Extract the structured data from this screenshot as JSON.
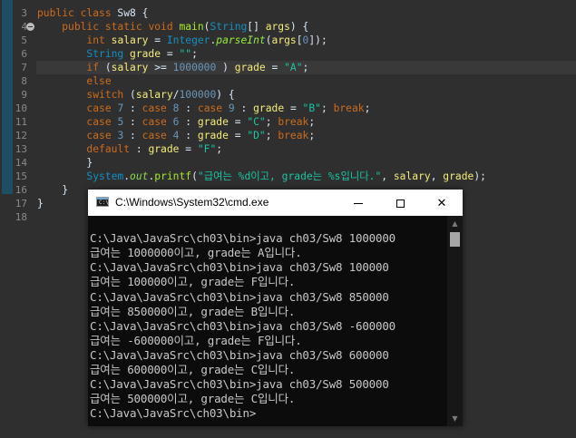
{
  "editor": {
    "line_numbers": [
      "3",
      "4",
      "5",
      "6",
      "7",
      "8",
      "9",
      "10",
      "11",
      "12",
      "13",
      "14",
      "15",
      "16",
      "17",
      "18"
    ],
    "lines": [
      {
        "n": "3",
        "tokens": [
          [
            "kw",
            "public "
          ],
          [
            "kw",
            "class "
          ],
          [
            "id",
            "Sw8 {"
          ]
        ]
      },
      {
        "n": "4",
        "tokens": [
          [
            "id",
            "    "
          ],
          [
            "kw",
            "public "
          ],
          [
            "kw",
            "static "
          ],
          [
            "kw",
            "void "
          ],
          [
            "mth",
            "main"
          ],
          [
            "id",
            "("
          ],
          [
            "ty",
            "String"
          ],
          [
            "id",
            "[] "
          ],
          [
            "var",
            "args"
          ],
          [
            "id",
            ") {"
          ]
        ]
      },
      {
        "n": "5",
        "tokens": [
          [
            "id",
            "        "
          ],
          [
            "kw",
            "int "
          ],
          [
            "var",
            "salary"
          ],
          [
            "id",
            " = "
          ],
          [
            "cls",
            "Integer"
          ],
          [
            "id",
            "."
          ],
          [
            "static-it",
            "parseInt"
          ],
          [
            "id",
            "("
          ],
          [
            "var",
            "args"
          ],
          [
            "id",
            "["
          ],
          [
            "num",
            "0"
          ],
          [
            "id",
            "]);"
          ]
        ]
      },
      {
        "n": "6",
        "tokens": [
          [
            "id",
            "        "
          ],
          [
            "ty",
            "String "
          ],
          [
            "var",
            "grade"
          ],
          [
            "id",
            " = "
          ],
          [
            "str",
            "\"\""
          ],
          [
            "id",
            ";"
          ]
        ]
      },
      {
        "n": "7",
        "tokens": [
          [
            "id",
            "        "
          ],
          [
            "kw",
            "if "
          ],
          [
            "id",
            "("
          ],
          [
            "var",
            "salary"
          ],
          [
            "id",
            " >= "
          ],
          [
            "num",
            "1000000"
          ],
          [
            "id",
            " ) "
          ],
          [
            "var",
            "grade"
          ],
          [
            "id",
            " = "
          ],
          [
            "str",
            "\"A\""
          ],
          [
            "id",
            ";"
          ]
        ]
      },
      {
        "n": "8",
        "tokens": [
          [
            "id",
            "        "
          ],
          [
            "kw",
            "else"
          ]
        ]
      },
      {
        "n": "9",
        "tokens": [
          [
            "id",
            "        "
          ],
          [
            "kw",
            "switch "
          ],
          [
            "id",
            "("
          ],
          [
            "var",
            "salary"
          ],
          [
            "id",
            "/"
          ],
          [
            "num",
            "100000"
          ],
          [
            "id",
            ") {"
          ]
        ]
      },
      {
        "n": "10",
        "tokens": [
          [
            "id",
            "        "
          ],
          [
            "kw",
            "case "
          ],
          [
            "num",
            "7"
          ],
          [
            "id",
            " : "
          ],
          [
            "kw",
            "case "
          ],
          [
            "num",
            "8"
          ],
          [
            "id",
            " : "
          ],
          [
            "kw",
            "case "
          ],
          [
            "num",
            "9"
          ],
          [
            "id",
            " : "
          ],
          [
            "var",
            "grade"
          ],
          [
            "id",
            " = "
          ],
          [
            "str",
            "\"B\""
          ],
          [
            "id",
            "; "
          ],
          [
            "kw",
            "break"
          ],
          [
            "id",
            ";"
          ]
        ]
      },
      {
        "n": "11",
        "tokens": [
          [
            "id",
            "        "
          ],
          [
            "kw",
            "case "
          ],
          [
            "num",
            "5"
          ],
          [
            "id",
            " : "
          ],
          [
            "kw",
            "case "
          ],
          [
            "num",
            "6"
          ],
          [
            "id",
            " : "
          ],
          [
            "var",
            "grade"
          ],
          [
            "id",
            " = "
          ],
          [
            "str",
            "\"C\""
          ],
          [
            "id",
            "; "
          ],
          [
            "kw",
            "break"
          ],
          [
            "id",
            ";"
          ]
        ]
      },
      {
        "n": "12",
        "tokens": [
          [
            "id",
            "        "
          ],
          [
            "kw",
            "case "
          ],
          [
            "num",
            "3"
          ],
          [
            "id",
            " : "
          ],
          [
            "kw",
            "case "
          ],
          [
            "num",
            "4"
          ],
          [
            "id",
            " : "
          ],
          [
            "var",
            "grade"
          ],
          [
            "id",
            " = "
          ],
          [
            "str",
            "\"D\""
          ],
          [
            "id",
            "; "
          ],
          [
            "kw",
            "break"
          ],
          [
            "id",
            ";"
          ]
        ]
      },
      {
        "n": "13",
        "tokens": [
          [
            "id",
            "        "
          ],
          [
            "kw",
            "default "
          ],
          [
            "id",
            ": "
          ],
          [
            "var",
            "grade"
          ],
          [
            "id",
            " = "
          ],
          [
            "str",
            "\"F\""
          ],
          [
            "id",
            ";"
          ]
        ]
      },
      {
        "n": "14",
        "tokens": [
          [
            "id",
            "        }"
          ]
        ]
      },
      {
        "n": "15",
        "tokens": [
          [
            "id",
            "        "
          ],
          [
            "cls",
            "System"
          ],
          [
            "id",
            "."
          ],
          [
            "fld",
            "out"
          ],
          [
            "id",
            "."
          ],
          [
            "mth",
            "printf"
          ],
          [
            "id",
            "("
          ],
          [
            "str",
            "\"급여는 %d이고, grade는 %s입니다.\""
          ],
          [
            "id",
            ", "
          ],
          [
            "var",
            "salary"
          ],
          [
            "id",
            ", "
          ],
          [
            "var",
            "grade"
          ],
          [
            "id",
            ");"
          ]
        ]
      },
      {
        "n": "16",
        "tokens": [
          [
            "id",
            "    }"
          ]
        ]
      },
      {
        "n": "17",
        "tokens": [
          [
            "id",
            "}"
          ]
        ]
      },
      {
        "n": "18",
        "tokens": []
      }
    ]
  },
  "cmd": {
    "title": "C:\\Windows\\System32\\cmd.exe",
    "minimize_label": "—",
    "close_label": "✕",
    "lines": [
      "",
      "C:\\Java\\JavaSrc\\ch03\\bin>java ch03/Sw8 1000000",
      "급여는 1000000이고, grade는 A입니다.",
      "C:\\Java\\JavaSrc\\ch03\\bin>java ch03/Sw8 100000",
      "급여는 100000이고, grade는 F입니다.",
      "C:\\Java\\JavaSrc\\ch03\\bin>java ch03/Sw8 850000",
      "급여는 850000이고, grade는 B입니다.",
      "C:\\Java\\JavaSrc\\ch03\\bin>java ch03/Sw8 -600000",
      "급여는 -600000이고, grade는 F입니다.",
      "C:\\Java\\JavaSrc\\ch03\\bin>java ch03/Sw8 600000",
      "급여는 600000이고, grade는 C입니다.",
      "C:\\Java\\JavaSrc\\ch03\\bin>java ch03/Sw8 500000",
      "급여는 500000이고, grade는 C입니다.",
      "C:\\Java\\JavaSrc\\ch03\\bin>"
    ]
  },
  "colors": {
    "editor_bg": "#2f2f2f",
    "keyword": "#cc6c1d",
    "string": "#17c6a3",
    "console_bg": "#0c0c0c",
    "console_text": "#c8c8c8"
  }
}
